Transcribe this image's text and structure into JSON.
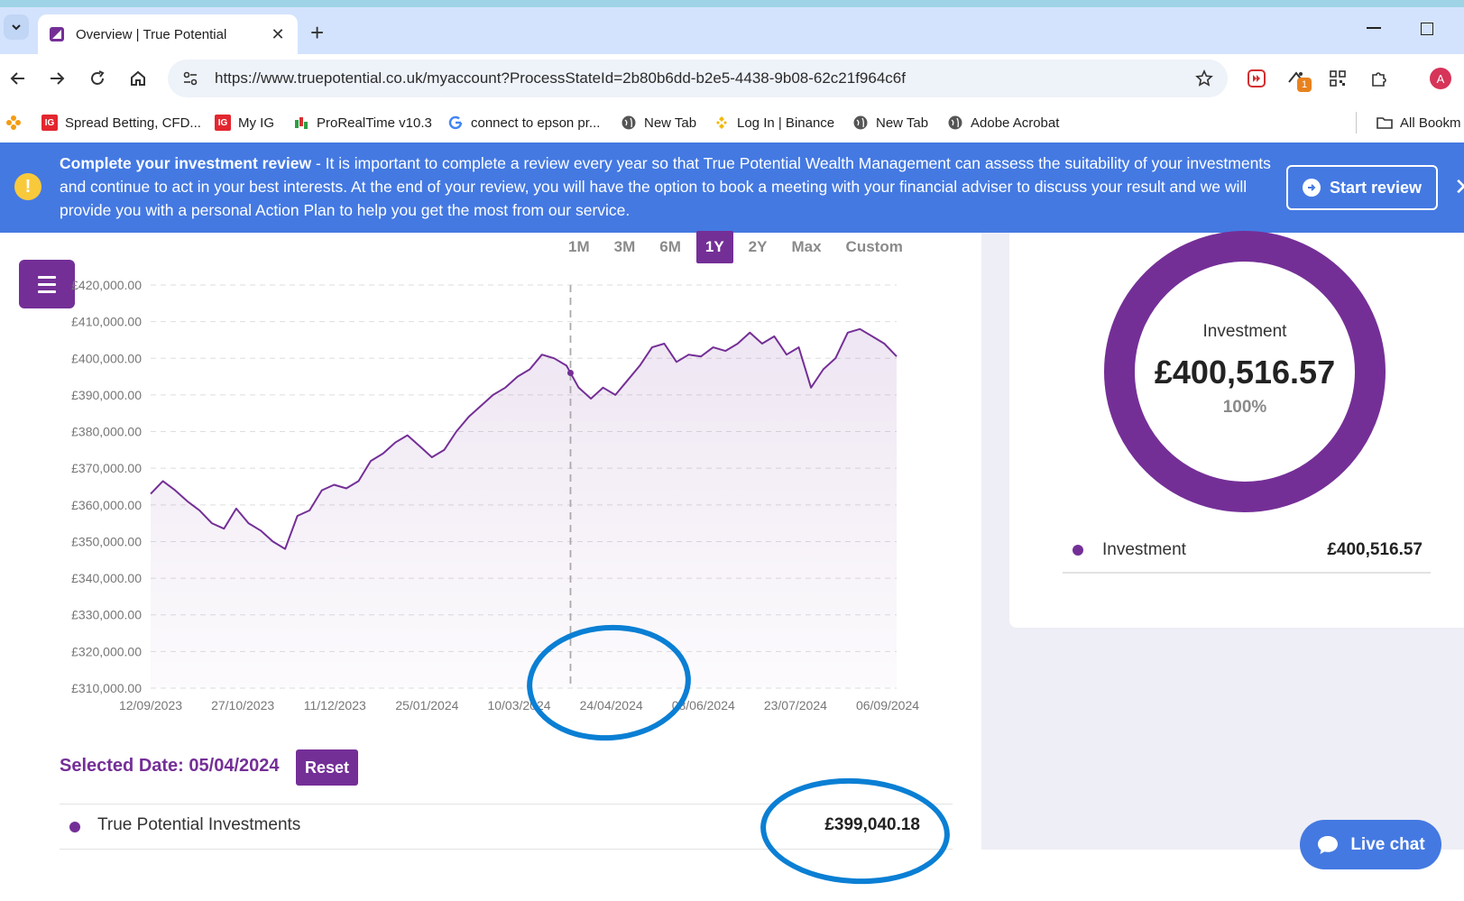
{
  "browser": {
    "tab_title": "Overview | True Potential",
    "new_tab_symbol": "+",
    "close_tab_symbol": "✕",
    "url": "https://www.truepotential.co.uk/myaccount?ProcessStateId=2b80b6dd-b2e5-4438-9b08-62c21f964c6f",
    "extension_badge": "1",
    "profile_initial": "A",
    "bookmarks": [
      {
        "label": "Spread Betting, CFD...",
        "icon": "ig-icon"
      },
      {
        "label": "My IG",
        "icon": "ig-icon"
      },
      {
        "label": "ProRealTime v10.3",
        "icon": "candlestick-icon"
      },
      {
        "label": "connect to epson pr...",
        "icon": "google-icon"
      },
      {
        "label": "New Tab",
        "icon": "globe-icon"
      },
      {
        "label": "Log In | Binance",
        "icon": "binance-icon"
      },
      {
        "label": "New Tab",
        "icon": "globe-icon"
      },
      {
        "label": "Adobe Acrobat",
        "icon": "globe-icon"
      }
    ],
    "all_bookmarks_label": "All Bookm"
  },
  "banner": {
    "title": "Complete your investment review",
    "text": " - It is important to complete a review every year so that True Potential Wealth Management can assess the suitability of your investments and continue to act in your best interests. At the end of your review, you will have the option to book a meeting with your financial adviser to discuss your result and we will provide you with a personal Action Plan to help you get the most from our service.",
    "button_label": "Start review",
    "warning_symbol": "!"
  },
  "range": {
    "options": [
      "1M",
      "3M",
      "6M",
      "1Y",
      "2Y",
      "Max",
      "Custom"
    ],
    "active": "1Y"
  },
  "chart_data": {
    "type": "area",
    "title": "",
    "xlabel": "",
    "ylabel": "",
    "ylim": [
      310000,
      420000
    ],
    "yticks": [
      "£420,000.00",
      "£410,000.00",
      "£400,000.00",
      "£390,000.00",
      "£380,000.00",
      "£370,000.00",
      "£360,000.00",
      "£350,000.00",
      "£340,000.00",
      "£330,000.00",
      "£320,000.00",
      "£310,000.00"
    ],
    "xticks": [
      "12/09/2023",
      "27/10/2023",
      "11/12/2023",
      "25/01/2024",
      "10/03/2024",
      "24/04/2024",
      "08/06/2024",
      "23/07/2024",
      "06/09/2024"
    ],
    "selected_day_index": 206,
    "total_days": 367,
    "series": [
      {
        "values": [
          363000,
          366500,
          364000,
          361000,
          358500,
          355000,
          353500,
          359000,
          355000,
          353000,
          350000,
          348000,
          357000,
          358500,
          364000,
          365500,
          364500,
          366500,
          372000,
          374000,
          377000,
          379000,
          376000,
          373000,
          375000,
          380000,
          384000,
          387000,
          390000,
          392000,
          395000,
          397000,
          401000,
          400000,
          398000,
          392000,
          389000,
          392000,
          390000,
          394000,
          398000,
          403000,
          404000,
          399000,
          401000,
          400500,
          403000,
          402000,
          404000,
          407000,
          404000,
          406000,
          401000,
          403000,
          392000,
          397000,
          400000,
          407000,
          408000,
          406000,
          404000,
          400500
        ],
        "color": "#742f97"
      }
    ]
  },
  "selection": {
    "label": "Selected Date: 05/04/2024",
    "reset_label": "Reset",
    "row_name": "True Potential Investments",
    "row_value": "£399,040.18"
  },
  "portfolio": {
    "donut_label": "Investment",
    "donut_value": "£400,516.57",
    "donut_percent": "100%",
    "donut_fraction": 1,
    "legend_label": "Investment",
    "legend_value": "£400,516.57"
  },
  "livechat_label": "Live chat",
  "colors": {
    "brand_purple": "#742f97",
    "banner_blue": "#4479e2",
    "annotation_blue": "#0a7fd4"
  }
}
